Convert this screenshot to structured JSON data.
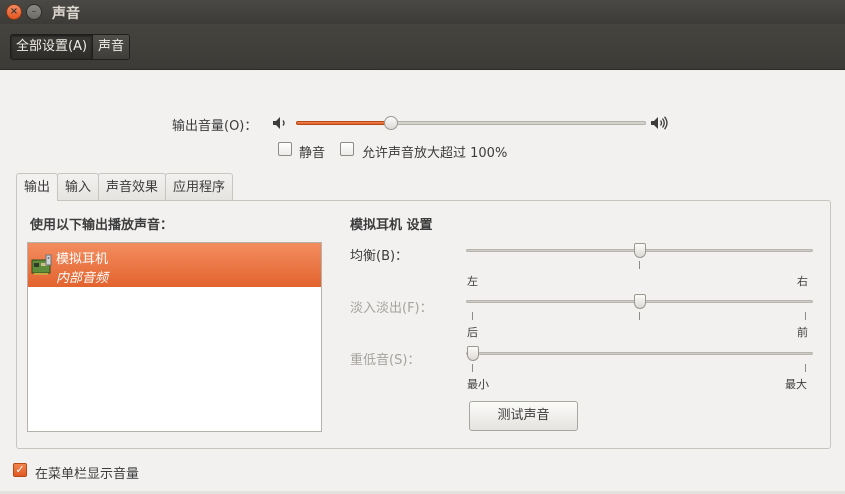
{
  "window": {
    "title": "声音"
  },
  "toolbar": {
    "crumbs": [
      "全部设置(A)",
      "声音"
    ]
  },
  "output_volume": {
    "label": "输出音量(O)：",
    "level_percent": 27
  },
  "options": {
    "mute_label": "静音",
    "mute_checked": false,
    "amplify_label": "允许声音放大超过 100%",
    "amplify_checked": false
  },
  "tabs": [
    "输出",
    "输入",
    "声音效果",
    "应用程序"
  ],
  "output": {
    "list_title": "使用以下输出播放声音：",
    "devices": [
      {
        "name": "模拟耳机",
        "description": "内部音频"
      }
    ],
    "settings_title": "模拟耳机 设置",
    "balance": {
      "label": "均衡(B)：",
      "left": "左",
      "right": "右",
      "position_fraction": 0.5
    },
    "fade": {
      "label": "淡入淡出(F)：",
      "rear": "后",
      "front": "前",
      "position_fraction": 0.5
    },
    "subwoofer": {
      "label": "重低音(S)：",
      "min": "最小",
      "max": "最大",
      "position_fraction": 0.0
    },
    "test_button": "测试声音"
  },
  "footer": {
    "show_in_menubar_label": "在菜单栏显示音量",
    "show_in_menubar_checked": true
  },
  "colors": {
    "accent": "#e3632e",
    "titlebar": "#3c3b37"
  },
  "icons": {
    "close": "close-icon",
    "minimize": "minimize-icon",
    "volume_low": "speaker-low-icon",
    "volume_high": "speaker-high-icon",
    "device": "sound-card-icon"
  }
}
